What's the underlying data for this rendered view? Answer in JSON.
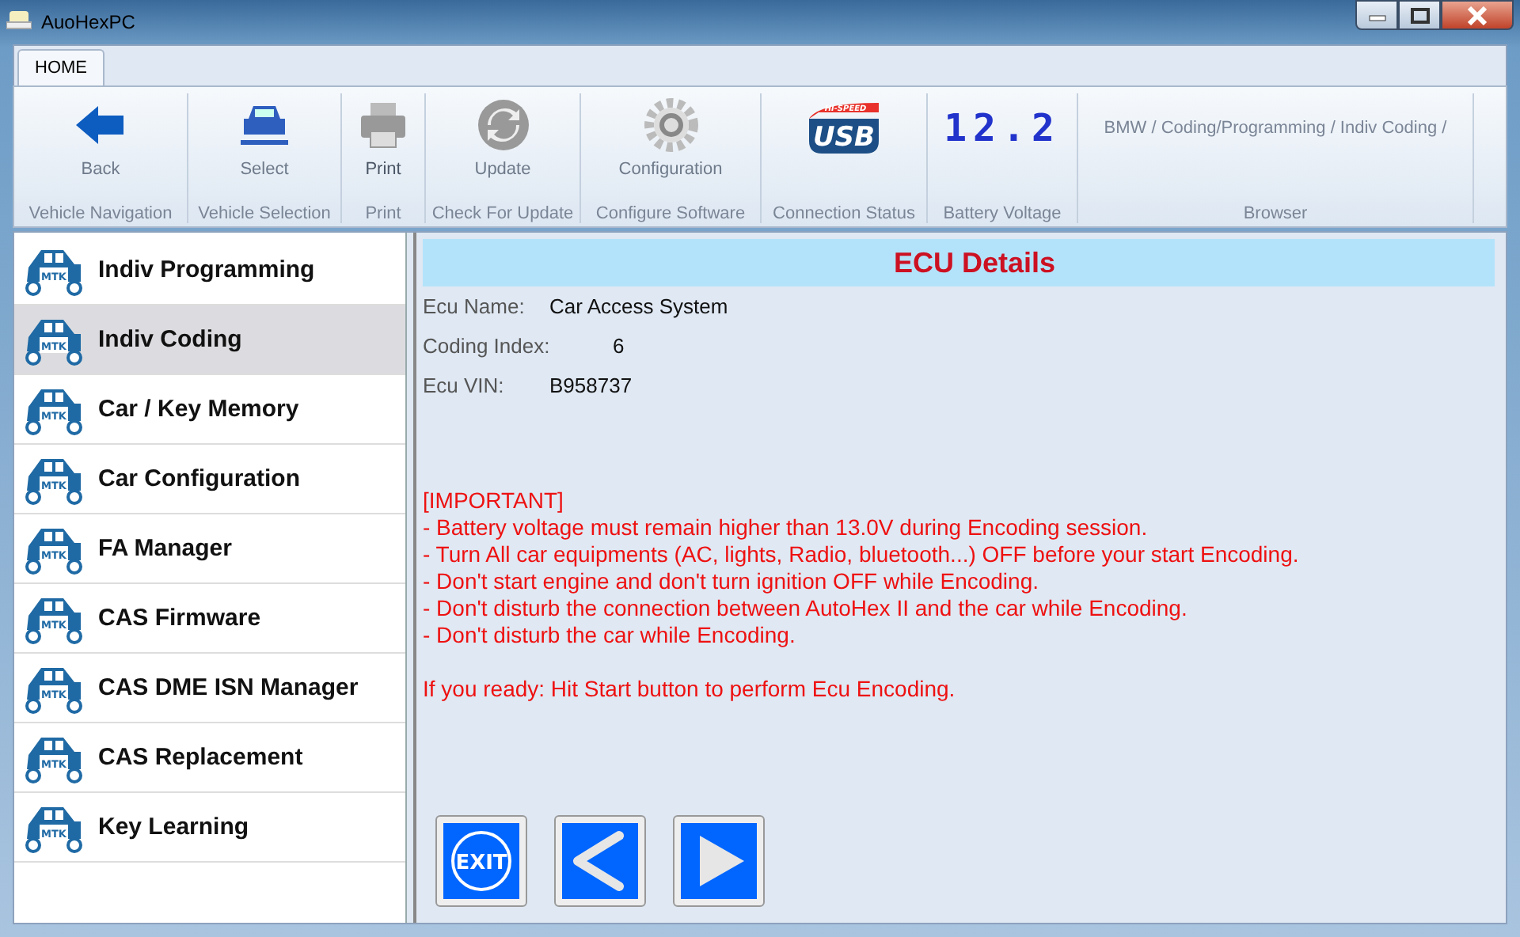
{
  "window": {
    "title": "AuoHexPC"
  },
  "tabs": [
    {
      "label": "HOME",
      "selected": true
    }
  ],
  "ribbon": [
    {
      "kind": "back",
      "label": "Back",
      "group": "Vehicle Navigation"
    },
    {
      "kind": "select",
      "label": "Select",
      "group": "Vehicle Selection"
    },
    {
      "kind": "print",
      "label": "Print",
      "group": "Print"
    },
    {
      "kind": "update",
      "label": "Update",
      "group": "Check For Update"
    },
    {
      "kind": "configuration",
      "label": "Configuration",
      "group": "Configure Software"
    },
    {
      "kind": "usb",
      "logo_text": "USB",
      "logo_badge": "HI-SPEED",
      "group": "Connection Status"
    },
    {
      "kind": "voltage",
      "reading": "12.2",
      "group": "Battery Voltage"
    },
    {
      "kind": "browser",
      "path": "BMW / Coding/Programming / Indiv Coding /",
      "group": "Browser"
    }
  ],
  "sidebar": {
    "items": [
      {
        "label": "Indiv Programming",
        "badge": "MTK",
        "selected": false
      },
      {
        "label": "Indiv Coding",
        "badge": "MTK",
        "selected": true
      },
      {
        "label": "Car / Key Memory",
        "badge": "MTK",
        "selected": false
      },
      {
        "label": "Car Configuration",
        "badge": "MTK",
        "selected": false
      },
      {
        "label": "FA Manager",
        "badge": "MTK",
        "selected": false
      },
      {
        "label": "CAS Firmware",
        "badge": "MTK",
        "selected": false
      },
      {
        "label": "CAS DME ISN Manager",
        "badge": "MTK",
        "selected": false
      },
      {
        "label": "CAS Replacement",
        "badge": "MTK",
        "selected": false
      },
      {
        "label": "Key Learning",
        "badge": "MTK",
        "selected": false
      }
    ]
  },
  "panel": {
    "title": "ECU Details",
    "fields": [
      {
        "label": "Ecu Name:",
        "value": "Car Access System"
      },
      {
        "label": "Coding Index:",
        "value": "6"
      },
      {
        "label": "Ecu VIN:",
        "value": "B958737"
      }
    ],
    "notice": [
      "[IMPORTANT]",
      "- Battery voltage must remain higher than 13.0V during Encoding session.",
      "- Turn All car equipments (AC, lights, Radio, bluetooth...) OFF before your start Encoding.",
      "- Don't start engine and don't turn ignition OFF while Encoding.",
      "- Don't disturb the connection between AutoHex II and the car while Encoding.",
      "- Don't disturb the car while Encoding."
    ],
    "prompt": "If you ready: Hit Start button to perform Ecu Encoding.",
    "buttons": [
      {
        "kind": "exit",
        "label": "EXIT"
      },
      {
        "kind": "back"
      },
      {
        "kind": "next"
      }
    ]
  }
}
